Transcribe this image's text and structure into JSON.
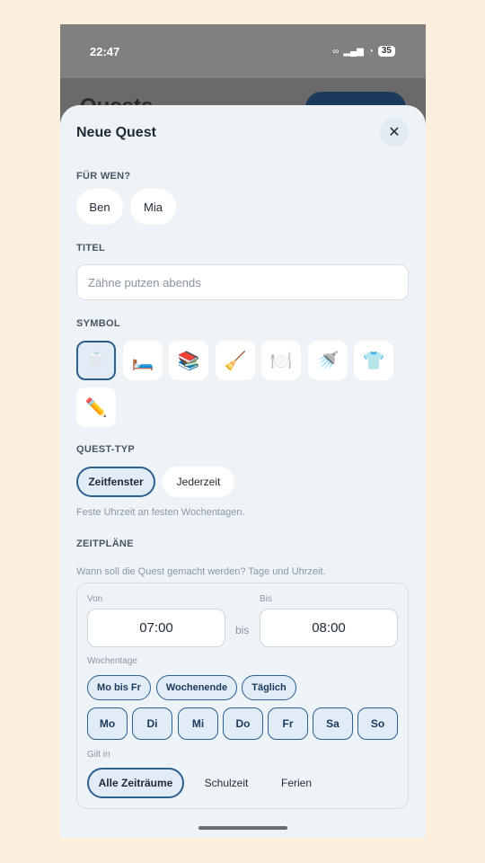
{
  "status_bar": {
    "time": "22:47",
    "battery": "35"
  },
  "background_screen": {
    "title": "Quests"
  },
  "sheet": {
    "title": "Neue Quest",
    "for_whom": {
      "label": "FÜR WEN?",
      "options": [
        "Ben",
        "Mia"
      ]
    },
    "title_field": {
      "label": "TITEL",
      "placeholder": "Zähne putzen abends"
    },
    "symbol": {
      "label": "SYMBOL",
      "icons": [
        "🦷",
        "🛏️",
        "📚",
        "🧹",
        "🍽️",
        "🚿",
        "👕",
        "✏️"
      ],
      "selected": "🦷"
    },
    "quest_type": {
      "label": "QUEST-TYP",
      "options": [
        "Zeitfenster",
        "Jederzeit"
      ],
      "selected": "Zeitfenster",
      "hint": "Feste Uhrzeit an festen Wochentagen."
    },
    "schedules": {
      "label": "ZEITPLÄNE",
      "hint": "Wann soll die Quest gemacht werden? Tage und Uhrzeit.",
      "from_label": "Von",
      "to_label": "Bis",
      "from": "07:00",
      "bis_text": "bis",
      "to": "08:00",
      "weekdays_label": "Wochentage",
      "presets": [
        "Mo bis Fr",
        "Wochenende",
        "Täglich"
      ],
      "days": [
        "Mo",
        "Di",
        "Mi",
        "Do",
        "Fr",
        "Sa",
        "So"
      ],
      "valid_label": "Gilt in",
      "periods": [
        "Alle Zeiträume",
        "Schulzeit",
        "Ferien"
      ],
      "selected_period": "Alle Zeiträume"
    }
  }
}
